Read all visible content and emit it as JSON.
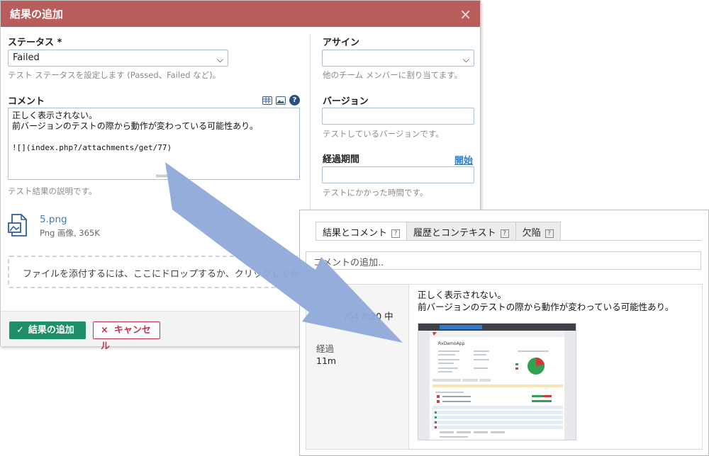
{
  "dialog": {
    "title": "結果の追加",
    "close_icon": "×",
    "status": {
      "label": "ステータス *",
      "value": "Failed",
      "help": "テスト ステータスを設定します (Passed、Failed など)。"
    },
    "comment": {
      "label": "コメント",
      "lines": [
        "正しく表示されない。",
        "前バージョンのテストの際から動作が変わっている可能性あり。",
        "",
        "![](index.php?/attachments/get/77)"
      ],
      "help": "テスト結果の説明です。",
      "help_icon": "?"
    },
    "attachment": {
      "name": "5.png",
      "meta": "Png 画像, 365K"
    },
    "dropzone": "ファイルを添付するには、ここにドロップするか、クリックして参照",
    "assign": {
      "label": "アサイン",
      "value": "",
      "help": "他のチーム メンバーに割り当てます。"
    },
    "version": {
      "label": "バージョン",
      "value": "",
      "help": "テストしているバージョンです。"
    },
    "elapsed": {
      "label": "経過期間",
      "start_link": "開始",
      "value": "",
      "help": "テストにかかった時間です。"
    },
    "ok_button": "結果の追加",
    "cancel_button": "キャンセル",
    "ok_icon": "✓",
    "cancel_icon": "×"
  },
  "result_panel": {
    "tabs": [
      {
        "label": "結果とコメント",
        "help": "?"
      },
      {
        "label": "履歴とコンテキスト",
        "help": "?"
      },
      {
        "label": "欠陥",
        "help": "?"
      }
    ],
    "comment_placeholder": "コメントの追加..",
    "left": {
      "date": "/04 8:20 中",
      "elapsed_label": "経過",
      "elapsed_value": "11m"
    },
    "text_lines": [
      "正しく表示されない。",
      "前バージョンのテストの際から動作が変わっている可能性あり。"
    ],
    "thumbnail": {
      "app_title": "RxDemoApp"
    }
  },
  "colors": {
    "titlebar": "#b85c5c",
    "ok_button": "#1f8e6a",
    "cancel_border": "#c0334f",
    "arrow_fill": "#8fa9d8"
  }
}
